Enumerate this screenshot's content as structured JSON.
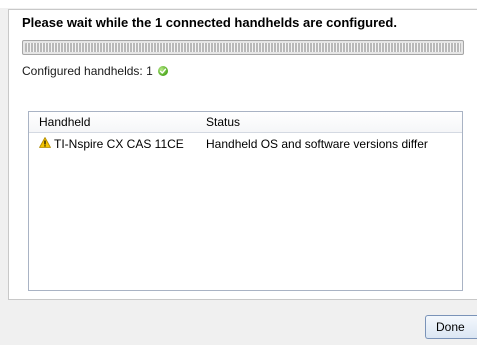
{
  "dialog": {
    "heading": "Please wait while the 1 connected handhelds are configured.",
    "progress": 1.0,
    "configured_label": "Configured handhelds: 1",
    "configured_icon": "check-circle-icon",
    "table": {
      "columns": [
        "Handheld",
        "Status"
      ],
      "rows": [
        {
          "icon": "warning-icon",
          "handheld": "TI-Nspire CX CAS 11CE",
          "status": "Handheld OS and software versions differ"
        }
      ]
    },
    "done_label": "Done"
  },
  "colors": {
    "accent_green": "#4da91e",
    "warning_yellow": "#f5c400",
    "button_border": "#7a93b8"
  }
}
